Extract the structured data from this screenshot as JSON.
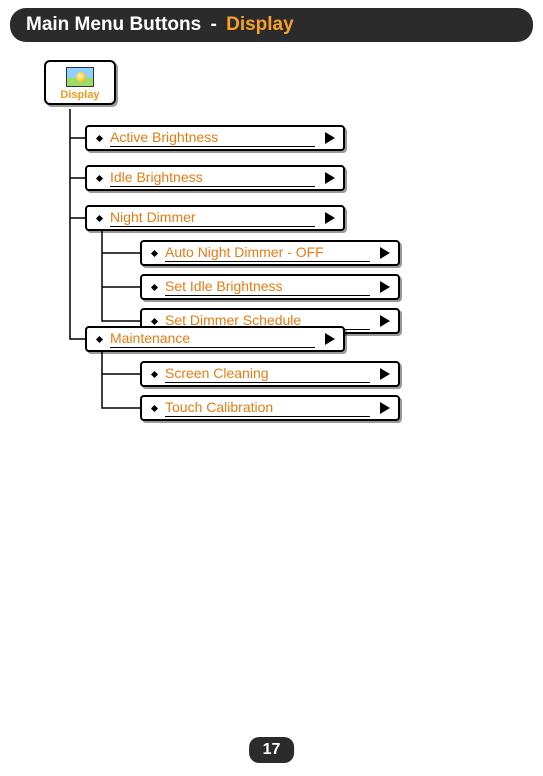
{
  "header": {
    "main": "Main Menu Buttons",
    "separator": "-",
    "sub": "Display"
  },
  "root": {
    "label": "Display"
  },
  "menu": {
    "active_brightness": "Active Brightness",
    "idle_brightness": "Idle Brightness",
    "night_dimmer": "Night Dimmer",
    "night_sub": {
      "auto_off": "Auto Night Dimmer - OFF",
      "set_idle": "Set Idle Brightness",
      "set_schedule": "Set Dimmer Schedule"
    },
    "maintenance": "Maintenance",
    "maint_sub": {
      "screen_cleaning": "Screen Cleaning",
      "touch_calibration": "Touch Calibration"
    }
  },
  "page_number": "17"
}
